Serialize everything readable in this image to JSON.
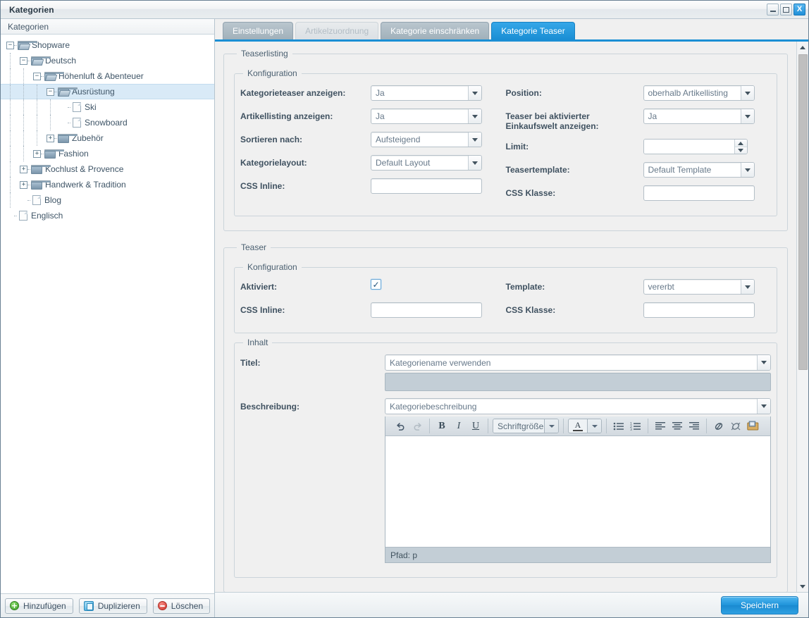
{
  "window": {
    "title": "Kategorien",
    "minimize_label": "Minimieren",
    "maximize_label": "Maximieren",
    "close_label": "X"
  },
  "sidebar": {
    "header": "Kategorien",
    "tree": [
      {
        "label": "Shopware",
        "depth": 0,
        "type": "folder-open",
        "expander": "minus",
        "selected": false
      },
      {
        "label": "Deutsch",
        "depth": 1,
        "type": "folder-open",
        "expander": "minus",
        "selected": false
      },
      {
        "label": "Höhenluft & Abenteuer",
        "depth": 2,
        "type": "folder-open",
        "expander": "minus",
        "selected": false
      },
      {
        "label": "Ausrüstung",
        "depth": 3,
        "type": "folder-open",
        "expander": "minus",
        "selected": true
      },
      {
        "label": "Ski",
        "depth": 4,
        "type": "doc",
        "expander": "none",
        "selected": false
      },
      {
        "label": "Snowboard",
        "depth": 4,
        "type": "doc",
        "expander": "none",
        "selected": false
      },
      {
        "label": "Zubehör",
        "depth": 3,
        "type": "folder",
        "expander": "plus",
        "selected": false
      },
      {
        "label": "Fashion",
        "depth": 2,
        "type": "folder",
        "expander": "plus",
        "selected": false
      },
      {
        "label": "Kochlust & Provence",
        "depth": 1,
        "type": "folder",
        "expander": "plus",
        "selected": false
      },
      {
        "label": "Handwerk & Tradition",
        "depth": 1,
        "type": "folder",
        "expander": "plus",
        "selected": false
      },
      {
        "label": "Blog",
        "depth": 1,
        "type": "doc",
        "expander": "none",
        "selected": false
      },
      {
        "label": "Englisch",
        "depth": 0,
        "type": "doc",
        "expander": "none",
        "selected": false
      }
    ],
    "footer": {
      "add": "Hinzufügen",
      "duplicate": "Duplizieren",
      "delete": "Löschen"
    }
  },
  "tabs": [
    {
      "label": "Einstellungen",
      "state": "normal"
    },
    {
      "label": "Artikelzuordnung",
      "state": "disabled"
    },
    {
      "label": "Kategorie einschränken",
      "state": "normal"
    },
    {
      "label": "Kategorie Teaser",
      "state": "active"
    }
  ],
  "teaserlisting": {
    "legend": "Teaserlisting",
    "config_legend": "Konfiguration",
    "left": [
      {
        "label": "Kategorieteaser anzeigen:",
        "control": "combo",
        "value": "Ja"
      },
      {
        "label": "Artikellisting anzeigen:",
        "control": "combo",
        "value": "Ja"
      },
      {
        "label": "Sortieren nach:",
        "control": "combo",
        "value": "Aufsteigend"
      },
      {
        "label": "Kategorielayout:",
        "control": "combo",
        "value": "Default Layout"
      },
      {
        "label": "CSS Inline:",
        "control": "text",
        "value": ""
      }
    ],
    "right": [
      {
        "label": "Position:",
        "control": "combo",
        "value": "oberhalb Artikellisting"
      },
      {
        "label": "Teaser bei aktivierter Einkaufswelt anzeigen:",
        "control": "combo",
        "value": "Ja"
      },
      {
        "label": "Limit:",
        "control": "spinner",
        "value": ""
      },
      {
        "label": "Teasertemplate:",
        "control": "combo",
        "value": "Default Template"
      },
      {
        "label": "CSS Klasse:",
        "control": "text",
        "value": ""
      }
    ]
  },
  "teaser": {
    "legend": "Teaser",
    "config_legend": "Konfiguration",
    "left": [
      {
        "label": "Aktiviert:",
        "control": "checkbox",
        "value": "✓",
        "checked": true
      },
      {
        "label": "CSS Inline:",
        "control": "text",
        "value": ""
      }
    ],
    "right": [
      {
        "label": "Template:",
        "control": "combo",
        "value": "vererbt"
      },
      {
        "label": "CSS Klasse:",
        "control": "text",
        "value": ""
      }
    ],
    "inhalt": {
      "legend": "Inhalt",
      "title_label": "Titel:",
      "title_value": "Kategoriename verwenden",
      "description_label": "Beschreibung:",
      "description_value": "Kategoriebeschreibung",
      "editor": {
        "toolbar": [
          {
            "name": "undo-icon",
            "glyph": "↺",
            "dim": false
          },
          {
            "name": "redo-icon",
            "glyph": "↻",
            "dim": true
          },
          {
            "name": "bold-icon",
            "glyph": "B",
            "dim": false
          },
          {
            "name": "italic-icon",
            "glyph": "I",
            "dim": false
          },
          {
            "name": "underline-icon",
            "glyph": "U",
            "dim": false
          }
        ],
        "fontsize_label": "Schriftgröße",
        "fontcolor_label": "A",
        "list_icons": [
          "unordered-list-icon",
          "ordered-list-icon"
        ],
        "align_icons": [
          "align-left-icon",
          "align-center-icon",
          "align-right-icon"
        ],
        "link_icons": [
          "link-icon",
          "unlink-icon",
          "insert-image-icon"
        ],
        "content": "",
        "status": "Pfad: p"
      }
    }
  },
  "actionbar": {
    "save": "Speichern"
  },
  "colors": {
    "accent": "#1b8fd4",
    "tab_active": "#1a8ed4",
    "selection": "#d9eaf7",
    "panel_bg": "#f0f0f0",
    "label_text": "#3f5160"
  },
  "scrollbar": {
    "up_arrow": "▲",
    "down_arrow": "▼"
  }
}
